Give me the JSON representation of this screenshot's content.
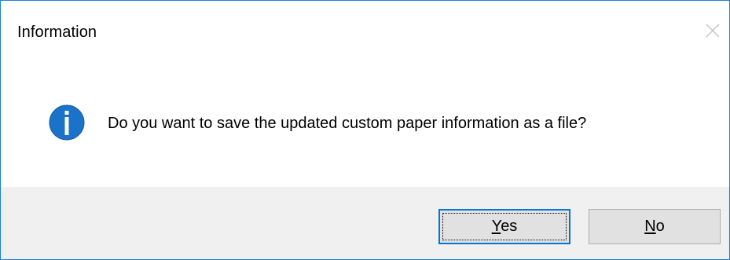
{
  "window": {
    "title": "Information",
    "close_icon": "close-icon"
  },
  "content": {
    "icon": "info-icon",
    "icon_color": "#1a73c8",
    "message": "Do you want to save the updated custom paper information as a file?"
  },
  "buttons": {
    "yes": {
      "accelerator": "Y",
      "rest": "es",
      "focused": true
    },
    "no": {
      "accelerator": "N",
      "rest": "o",
      "focused": false
    }
  },
  "colors": {
    "accent": "#0078d7",
    "window_border": "#1883d7",
    "footer_background": "#f0f0f0"
  }
}
